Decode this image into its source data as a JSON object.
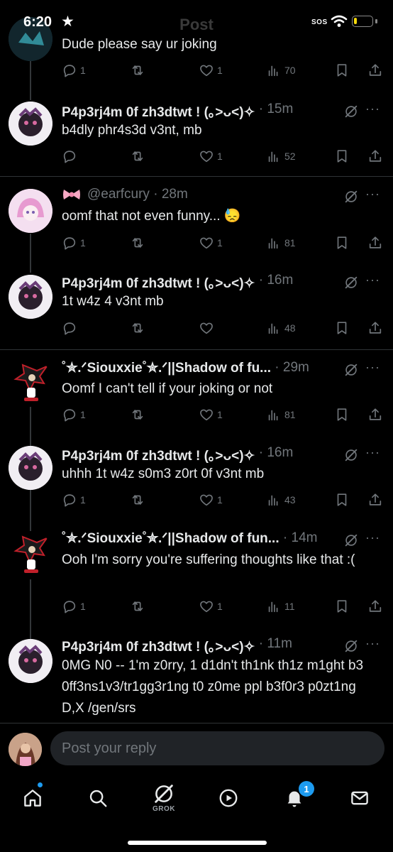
{
  "status_bar": {
    "time": "6:20",
    "star": "★",
    "header_title": "Post",
    "sos": "SOS",
    "battery_level": 0.18
  },
  "colors": {
    "background": "#000000",
    "text": "#e7e9ea",
    "muted": "#71767b",
    "accent": "#1d9bf0",
    "battery": "#f5d90a"
  },
  "tweets": [
    {
      "body": "Dude please say ur joking",
      "reply_count": "1",
      "like_count": "1",
      "views": "70"
    },
    {
      "name": "P4p3rj4m 0f zh3dtwt ! (｡˃ᴗ˂)✧",
      "time": "15m",
      "body": "b4dly phr4s3d v3nt, mb",
      "reply_count": "",
      "like_count": "1",
      "views": "52"
    },
    {
      "handle": "@earfcury",
      "time": "28m",
      "body": "oomf that not even funny... 😓",
      "reply_count": "1",
      "like_count": "1",
      "views": "81"
    },
    {
      "name": "P4p3rj4m 0f zh3dtwt ! (｡˃ᴗ˂)✧",
      "time": "16m",
      "body": "1t w4z 4 v3nt mb",
      "reply_count": "",
      "like_count": "",
      "views": "48"
    },
    {
      "name": "˚✮.ᐟSiouxxie˚✮.ᐟ||Shadow of fu...",
      "time": "29m",
      "body": "Oomf I can't tell if your joking or not",
      "reply_count": "1",
      "like_count": "1",
      "views": "81"
    },
    {
      "name": "P4p3rj4m 0f zh3dtwt ! (｡˃ᴗ˂)✧",
      "time": "16m",
      "body": "uhhh 1t w4z s0m3 z0rt 0f v3nt mb",
      "reply_count": "1",
      "like_count": "1",
      "views": "43"
    },
    {
      "name": "˚✮.ᐟSiouxxie˚✮.ᐟ||Shadow of fun...",
      "time": "14m",
      "body": "Ooh I'm sorry you're suffering thoughts like that :(",
      "reply_count": "1",
      "like_count": "1",
      "views": "11"
    },
    {
      "name": "P4p3rj4m 0f zh3dtwt ! (｡˃ᴗ˂)✧",
      "time": "11m",
      "body": "0MG N0 -- 1'm z0rry, 1 d1dn't th1nk th1z m1ght b3 0ff3ns1v3/tr1gg3r1ng t0 z0me ppl b3f0r3 p0zt1ng D,X /gen/srs"
    }
  ],
  "reply_bar": {
    "placeholder": "Post your reply"
  },
  "tab_bar": {
    "grok_label": "GROK",
    "notification_count": "1",
    "icons": [
      "home-icon",
      "search-icon",
      "grok-icon",
      "video-icon",
      "bell-icon",
      "mail-icon"
    ]
  }
}
